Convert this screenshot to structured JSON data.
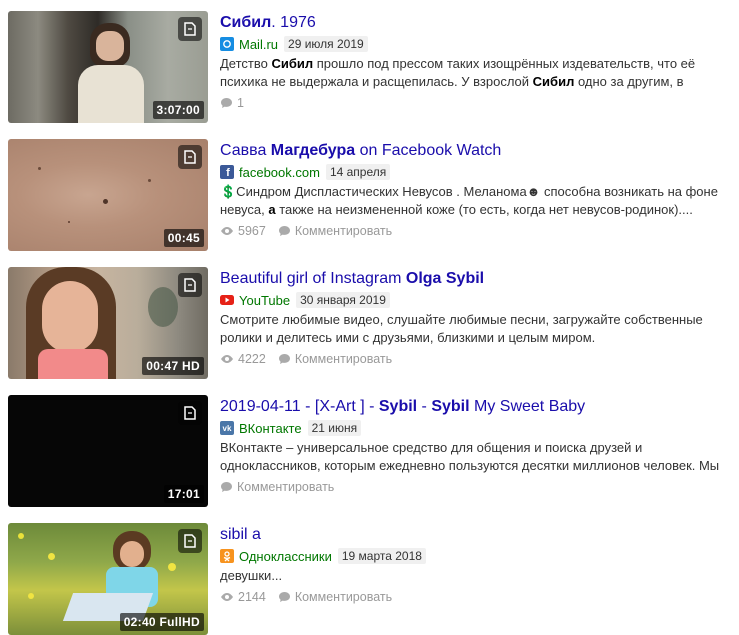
{
  "results": [
    {
      "title_prefix": "",
      "title_bold": "Сибил",
      "title_suffix": ". 1976",
      "source": "Mail.ru",
      "source_icon": "mailru-icon",
      "date": "29 июля 2019",
      "desc": [
        {
          "t": "Детство ",
          "b": false
        },
        {
          "t": "Сибил",
          "b": true
        },
        {
          "t": " прошло под прессом таких изощрённых издевательств, что её психика не выдержала и расщепилась. У взрослой ",
          "b": false
        },
        {
          "t": "Сибил",
          "b": true
        },
        {
          "t": " одно за другим, в",
          "b": false
        }
      ],
      "views": "",
      "comments": "1",
      "duration": "3:07:00"
    },
    {
      "title_prefix": "Савва ",
      "title_bold": "Магдебура",
      "title_suffix": " on Facebook Watch",
      "source": "facebook.com",
      "source_icon": "facebook-icon",
      "date": "14 апреля",
      "desc": [
        {
          "t": "💲Синдром Диспластических Невусов . Меланома☻ способна возникать на фоне невуса, ",
          "b": false
        },
        {
          "t": "а",
          "b": true
        },
        {
          "t": " также на неизмененной коже (то есть, когда нет невусов-родинок)....",
          "b": false
        }
      ],
      "views": "5967",
      "comments": "Комментировать",
      "duration": "00:45"
    },
    {
      "title_prefix": "Beautiful girl of Instagram ",
      "title_bold": "Olga Sybil",
      "title_suffix": "",
      "source": "YouTube",
      "source_icon": "youtube-icon",
      "date": "30 января 2019",
      "desc": [
        {
          "t": "Смотрите любимые видео, слушайте любимые песни, загружайте собственные ролики и делитесь ими с друзьями, близкими и целым миром.",
          "b": false
        }
      ],
      "views": "4222",
      "comments": "Комментировать",
      "duration": "00:47 HD"
    },
    {
      "title_prefix": "2019-04-11 - [X-Art ] - ",
      "title_bold": "Sybil",
      "title_mid": " - ",
      "title_bold2": "Sybil",
      "title_suffix": " My Sweet Baby",
      "source": "ВКонтакте",
      "source_icon": "vk-icon",
      "date": "21 июня",
      "desc": [
        {
          "t": "ВКонтакте – универсальное средство для общения и поиска друзей и одноклассников, которым ежедневно пользуются десятки миллионов человек. Мы",
          "b": false
        }
      ],
      "views": "",
      "comments": "Комментировать",
      "duration": "17:01"
    },
    {
      "title_prefix": "sibil a",
      "title_bold": "",
      "title_suffix": "",
      "source": "Одноклассники",
      "source_icon": "odnoklassniki-icon",
      "date": "19 марта 2018",
      "desc": [
        {
          "t": "девушки...",
          "b": false
        }
      ],
      "views": "2144",
      "comments": "Комментировать",
      "duration": "02:40 FullHD"
    }
  ],
  "colors": {
    "link": "#1a0dab",
    "source": "#007700",
    "muted": "#999999"
  }
}
